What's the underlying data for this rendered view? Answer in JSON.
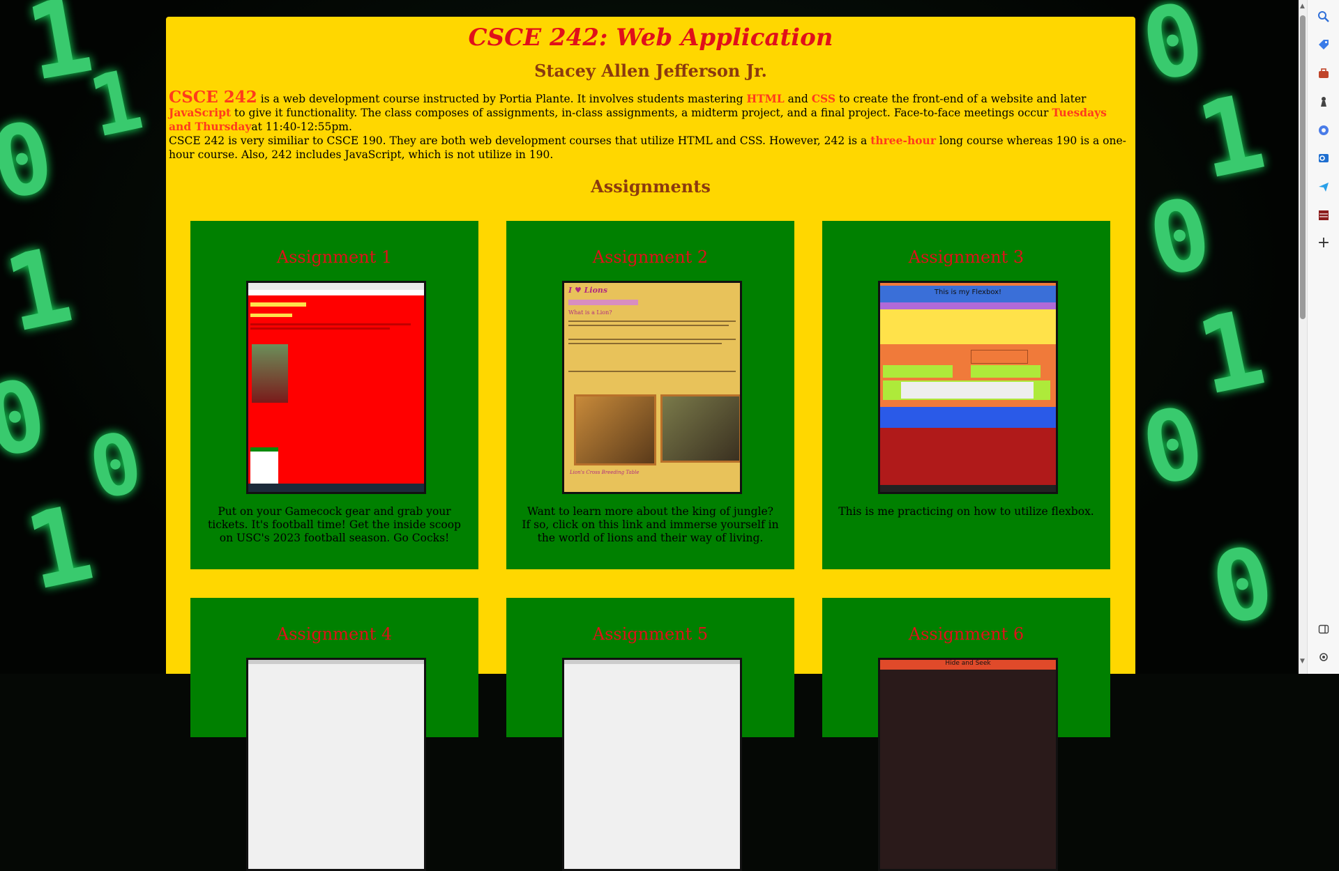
{
  "page": {
    "title": "CSCE 242: Web Application",
    "author": "Stacey Allen Jefferson Jr.",
    "assignments_heading": "Assignments"
  },
  "intro": {
    "p1": {
      "course_code": "CSCE 242",
      "text_a": " is a web development course instructed by Portia Plante. It involves students mastering ",
      "html": "HTML",
      "text_b": " and ",
      "css": "CSS",
      "text_c": " to create the front-end of a website and later ",
      "js": "JavaScript",
      "text_d": " to give it functionality. The class composes of assignments, in-class assignments, a midterm project, and a final project. Face-to-face meetings occur ",
      "days": "Tuesdays and Thursday",
      "text_e": "at 11:40-12:55pm."
    },
    "p2": {
      "text_a": "CSCE 242 is very similiar to CSCE 190. They are both web development courses that utilize HTML and CSS. However, 242 is a ",
      "three_hour": "three-hour",
      "text_b": " long course whereas 190 is a one-hour course. Also, 242 includes JavaScript, which is not utilize in 190."
    }
  },
  "assignments": [
    {
      "title": "Assignment 1",
      "desc": "Put on your Gamecock gear and grab your tickets. It's football time! Get the inside scoop on USC's 2023 football season. Go Cocks!"
    },
    {
      "title": "Assignment 2",
      "desc": "Want to learn more about the king of jungle? If so, click on this link and immerse yourself in the world of lions and their way of living."
    },
    {
      "title": "Assignment 3",
      "desc": "This is me practicing on how to utilize flexbox."
    },
    {
      "title": "Assignment 4",
      "desc": ""
    },
    {
      "title": "Assignment 5",
      "desc": ""
    },
    {
      "title": "Assignment 6",
      "desc": ""
    }
  ],
  "thumbnails": {
    "t2_heading": "I ♥ Lions",
    "t2_sub": "What is a Lion?",
    "t2_table": "Lion's Cross Breeding Table",
    "t3_heading": "This is my Flexbox!",
    "t6_heading": "Hide and Seek"
  },
  "sidebar_icons": [
    "search-icon",
    "tag-icon",
    "briefcase-icon",
    "chess-icon",
    "copilot-icon",
    "outlook-icon",
    "send-icon",
    "flag-icon",
    "add-icon",
    "panel-icon",
    "settings-icon"
  ],
  "colors": {
    "panel": "#ffd700",
    "card": "#008000",
    "title_red": "#e0101a",
    "highlight": "#ff3b1c",
    "heading_brown": "#8b3a0f"
  }
}
